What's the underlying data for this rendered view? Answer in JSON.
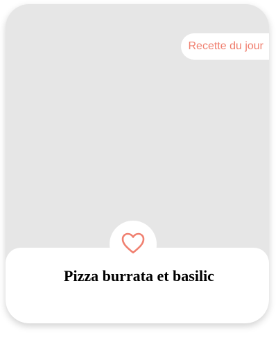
{
  "card": {
    "badge_label": "Recette du jour",
    "title": "Pizza burrata et basilic",
    "favorite_icon": "heart-outline-icon"
  },
  "colors": {
    "accent": "#f08070",
    "image_placeholder": "#e6e6e6",
    "panel": "#ffffff",
    "title_text": "#000000"
  }
}
